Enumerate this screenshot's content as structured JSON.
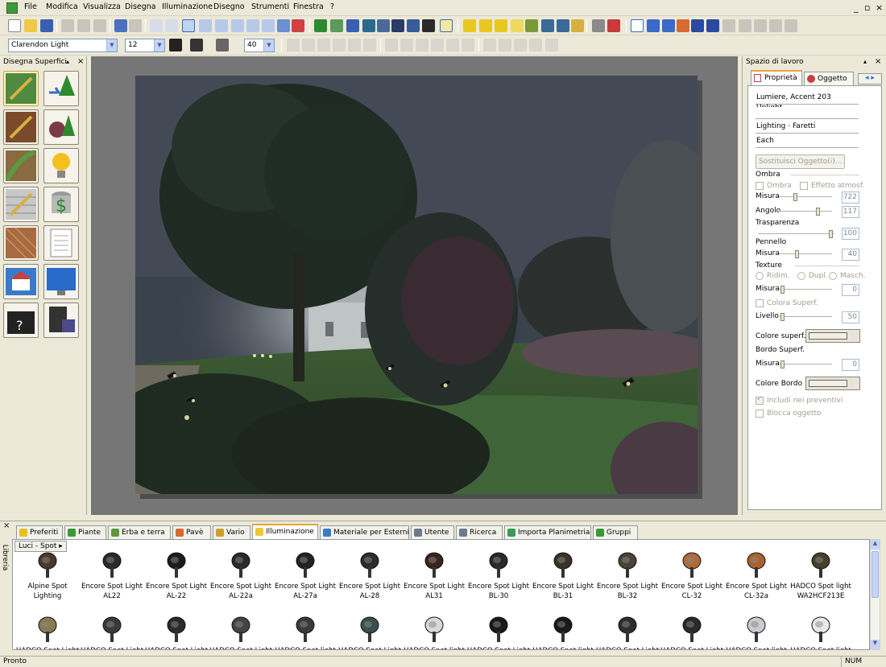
{
  "menu": [
    "File",
    "Modifica",
    "Visualizza",
    "Disegna",
    "Illuminazione",
    "Disegno",
    "Strumenti",
    "Finestra",
    "?"
  ],
  "window_controls": [
    "_",
    "▫",
    "×"
  ],
  "format": {
    "font": "Clarendon Light",
    "size": "12",
    "zoom": "40"
  },
  "left_panel": {
    "title": "Disegna Superfici",
    "close": "×",
    "pin": "▴"
  },
  "right_panel": {
    "title": "Spazio di lavoro",
    "tabs": [
      "Proprietà",
      "Oggetto"
    ],
    "fields": [
      "Lumiere, Accent 203 Uplight",
      "",
      "Lighting · Faretti",
      "Each"
    ],
    "replace_button": "Sostituisci Oggetto(i)...",
    "shadow": {
      "label": "Ombra",
      "check1": "Ombra",
      "check2": "Effetto atmosf.",
      "size_label": "Misura",
      "size": "722",
      "angle_label": "Angolo",
      "angle": "117"
    },
    "transparency": {
      "label": "Trasparenza",
      "value": "100"
    },
    "brush": {
      "label": "Pennello",
      "size_label": "Misura",
      "size": "40"
    },
    "texture": {
      "label": "Texture",
      "opt1": "Ridim.",
      "opt2": "Dupl.",
      "opt3": "Masch.",
      "size_label": "Misura",
      "size": "0",
      "color_check": "Colora Superf."
    },
    "level": {
      "label": "Livello",
      "value": "50"
    },
    "surface_color_label": "Colore superf.",
    "surface_border_label": "Bordo Superf.",
    "border_size_label": "Misura",
    "border_size": "0",
    "border_color_label": "Colore Bordo",
    "include_estimates": "Includi nei preventivi",
    "lock_object": "Blocca oggetto"
  },
  "library": {
    "side_label": "Libreria",
    "close": "×",
    "tabs": [
      {
        "label": "Preferiti",
        "color": "#e8c020"
      },
      {
        "label": "Piante",
        "color": "#3a9a3a"
      },
      {
        "label": "Erba e terra",
        "color": "#5a9a3a"
      },
      {
        "label": "Pavè",
        "color": "#d86a30"
      },
      {
        "label": "Vario",
        "color": "#c8a030"
      },
      {
        "label": "Illuminazione",
        "color": "#f0c830"
      },
      {
        "label": "Materiale per Esterni",
        "color": "#3a7ac8"
      },
      {
        "label": "Utente",
        "color": "#6a7a8a"
      },
      {
        "label": "Ricerca",
        "color": "#6a7a8a"
      },
      {
        "label": "Importa Planimetria",
        "color": "#3a9a5a"
      },
      {
        "label": "Gruppi",
        "color": "#3a9a3a"
      }
    ],
    "active_tab": "Illuminazione",
    "category": "Luci - Spot ▸",
    "row1": [
      [
        "Alpine Spot",
        "Lighting"
      ],
      [
        "Encore Spot Light",
        "AL22"
      ],
      [
        "Encore Spot Light",
        "AL-22"
      ],
      [
        "Encore Spot Light",
        "AL-22a"
      ],
      [
        "Encore Spot Light",
        "AL-27a"
      ],
      [
        "Encore Spot Light",
        "AL-28"
      ],
      [
        "Encore Spot Light",
        "AL31"
      ],
      [
        "Encore Spot Light",
        "BL-30"
      ],
      [
        "Encore Spot Light",
        "BL-31"
      ],
      [
        "Encore Spot Light",
        "BL-32"
      ],
      [
        "Encore Spot Light",
        "CL-32"
      ],
      [
        "Encore Spot Light",
        "CL-32a"
      ],
      [
        "HADCO Spot light",
        "WA2HCF213E"
      ]
    ],
    "row2": [
      "HADCO Spot Light",
      "HADCO Spot Light",
      "HADCO Spot Light",
      "HADCO Spot Light",
      "HADCO Spot light",
      "HADCO Spot Light",
      "HADCO Spot light",
      "HADCO Spot Light",
      "HADCO Spot light",
      "HADCO Spot Light",
      "HADCO Spot Light",
      "HADCO Spot light",
      "HADCO Spot light"
    ]
  },
  "status": {
    "left": "Pronto",
    "right": "NUM"
  }
}
